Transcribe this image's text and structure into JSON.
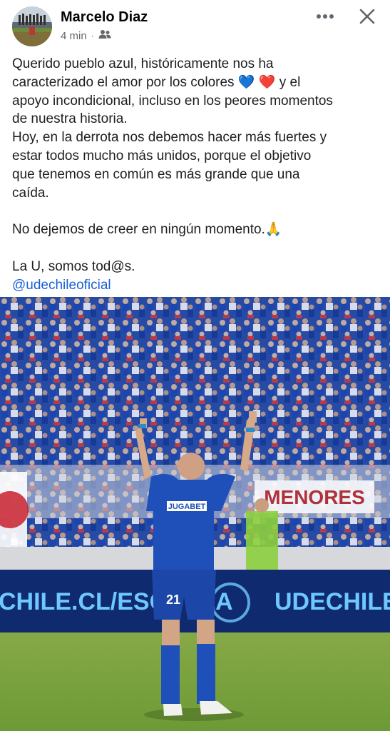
{
  "post": {
    "author": "Marcelo Diaz",
    "time": "4 min",
    "audience_icon": "friends-icon",
    "text": {
      "p1": "Querido pueblo azul, históricamente nos ha",
      "p1b": "caracterizado el amor por los colores",
      "p1c": "y el",
      "p1d": "apoyo incondicional, incluso en los peores momentos",
      "p1e": "de nuestra historia.",
      "p2a": "Hoy, en la derrota nos debemos hacer más fuertes y",
      "p2b": "estar todos mucho más unidos, porque el objetivo",
      "p2c": "que tenemos en común es más grande que una",
      "p2d": "caída.",
      "p3": "No dejemos de creer en ningún momento.",
      "p4": "La U, somos tod@s.",
      "mention": "@udechileoficial"
    },
    "emoji": {
      "blue_heart": "💙",
      "red_heart": "❤️",
      "pray": "🙏"
    }
  },
  "photo": {
    "banner_menores": "MENORES",
    "board_left": "CHILE.CL/ESCUELA",
    "board_right": "UDECHILE.CL/",
    "sponsor": "JUGABET",
    "shirt_number": "21"
  },
  "colors": {
    "mention": "#1b5fd6",
    "kit_blue": "#1f4fb8",
    "board_blue": "#0f2a6e",
    "pitch_green": "#7aa33f"
  }
}
